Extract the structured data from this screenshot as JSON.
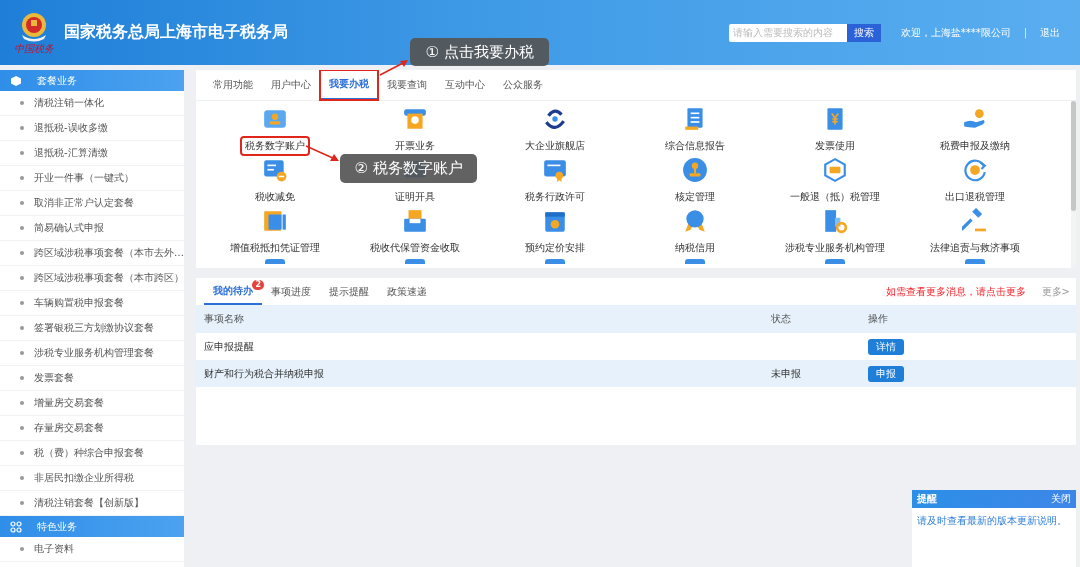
{
  "header": {
    "emblem_caption": "中国税务",
    "title": "国家税务总局上海市电子税务局",
    "search": {
      "placeholder": "请输入需要搜索的内容",
      "button": "搜索"
    },
    "welcome": "欢迎，上海盐****限公司",
    "separator": "|",
    "logout": "退出"
  },
  "sidebar": {
    "sections": [
      {
        "title": "套餐业务",
        "items": [
          "清税注销一体化",
          "退抵税-误收多缴",
          "退抵税-汇算清缴",
          "开业一件事（一键式）",
          "取消非正常户认定套餐",
          "简易确认式申报",
          "跨区域涉税事项套餐（本市去外…",
          "跨区域涉税事项套餐（本市跨区）",
          "车辆购置税申报套餐",
          "签署银税三方划缴协议套餐",
          "涉税专业服务机构管理套餐",
          "发票套餐",
          "增量房交易套餐",
          "存量房交易套餐",
          "税（费）种综合申报套餐",
          "非居民扣缴企业所得税",
          "清税注销套餐【创新版】"
        ]
      },
      {
        "title": "特色业务",
        "items": [
          "电子资料"
        ]
      }
    ]
  },
  "main_tabs": [
    {
      "label": "常用功能",
      "selected": false,
      "highlighted": false
    },
    {
      "label": "用户中心",
      "selected": false,
      "highlighted": false
    },
    {
      "label": "我要办税",
      "selected": true,
      "highlighted": true
    },
    {
      "label": "我要查询",
      "selected": false,
      "highlighted": false
    },
    {
      "label": "互动中心",
      "selected": false,
      "highlighted": false
    },
    {
      "label": "公众服务",
      "selected": false,
      "highlighted": false
    }
  ],
  "services": [
    {
      "label": "税务数字账户",
      "highlighted": true
    },
    {
      "label": "开票业务",
      "highlighted": false
    },
    {
      "label": "大企业旗舰店",
      "highlighted": false
    },
    {
      "label": "综合信息报告",
      "highlighted": false
    },
    {
      "label": "发票使用",
      "highlighted": false
    },
    {
      "label": "税费申报及缴纳",
      "highlighted": false
    },
    {
      "label": "税收减免",
      "highlighted": false
    },
    {
      "label": "证明开具",
      "highlighted": false
    },
    {
      "label": "税务行政许可",
      "highlighted": false
    },
    {
      "label": "核定管理",
      "highlighted": false
    },
    {
      "label": "一般退（抵）税管理",
      "highlighted": false
    },
    {
      "label": "出口退税管理",
      "highlighted": false
    },
    {
      "label": "增值税抵扣凭证管理",
      "highlighted": false
    },
    {
      "label": "税收代保管资金收取",
      "highlighted": false
    },
    {
      "label": "预约定价安排",
      "highlighted": false
    },
    {
      "label": "纳税信用",
      "highlighted": false
    },
    {
      "label": "涉税专业服务机构管理",
      "highlighted": false
    },
    {
      "label": "法律追责与救济事项",
      "highlighted": false
    }
  ],
  "todo_panel": {
    "tabs": [
      {
        "label": "我的待办",
        "selected": true,
        "badge": "2"
      },
      {
        "label": "事项进度",
        "selected": false
      },
      {
        "label": "提示提醒",
        "selected": false
      },
      {
        "label": "政策速递",
        "selected": false
      }
    ],
    "notice": "如需查看更多消息，请点击更多",
    "more": "更多>",
    "columns": [
      "事项名称",
      "状态",
      "操作"
    ],
    "rows": [
      {
        "name": "应申报提醒",
        "action": "详情"
      },
      {
        "name": "财产和行为税合并纳税申报",
        "status": "未申报",
        "action": "申报"
      }
    ]
  },
  "popup": {
    "title": "提醒",
    "close": "关闭",
    "message": "请及时查看最新的版本更新说明。"
  },
  "annotations": [
    "① 点击我要办税",
    "② 税务数字账户"
  ]
}
